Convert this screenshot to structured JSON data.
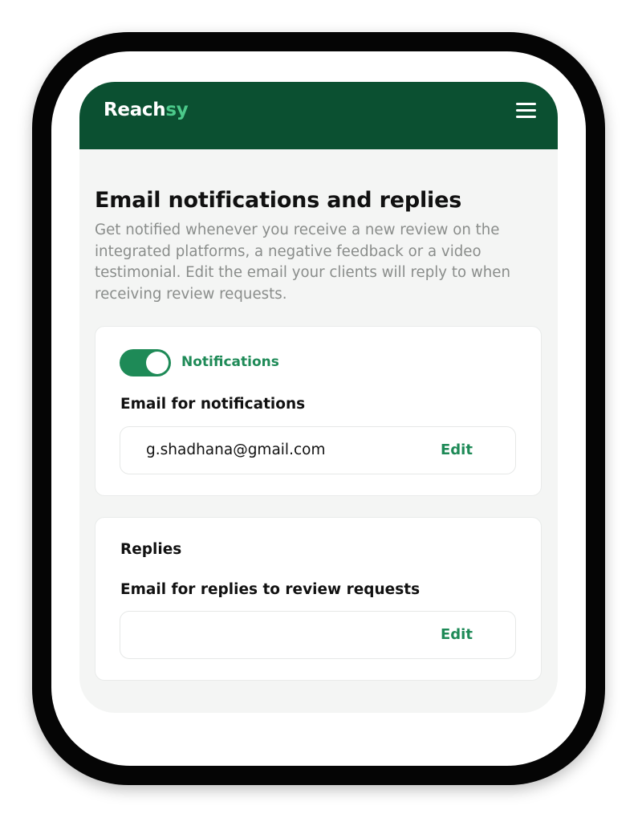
{
  "brand": {
    "logo_main": "Reach",
    "logo_accent": "sy",
    "colors": {
      "header_bg": "#0b5031",
      "accent": "#1e8a57",
      "logo_accent": "#4cc98a"
    }
  },
  "header": {
    "menu_icon": "hamburger-menu-icon"
  },
  "page": {
    "title": "Email notifications and replies",
    "description": "Get notified whenever you receive a new review on the integrated platforms, a negative feedback or a video testimonial. Edit the email your clients will reply to when receiving review requests."
  },
  "notifications_card": {
    "toggle_on": true,
    "toggle_label": "Notifications",
    "field_label": "Email for notifications",
    "email": "g.shadhana@gmail.com",
    "edit_label": "Edit"
  },
  "replies_card": {
    "section_label": "Replies",
    "field_label": "Email for replies to review requests",
    "email": "",
    "edit_label": "Edit"
  }
}
